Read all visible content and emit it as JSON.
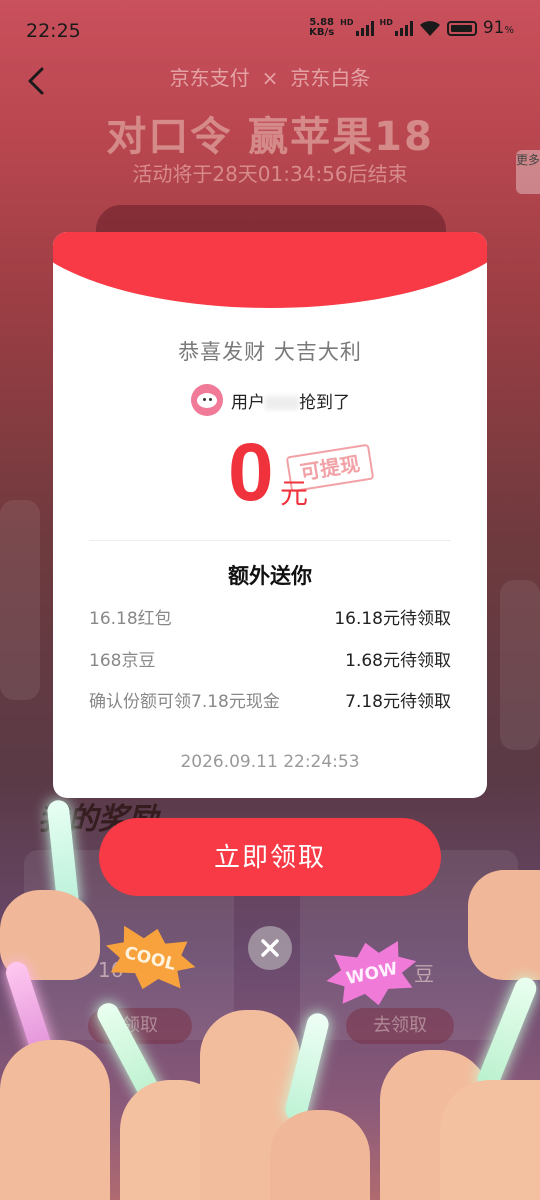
{
  "status_bar": {
    "time": "22:25",
    "net_speed_value": "5.88",
    "net_speed_unit": "KB/s",
    "hd_label": "HD",
    "battery_percent": "91"
  },
  "background": {
    "brand_left": "京东支付",
    "brand_sep": "×",
    "brand_right": "京东白条",
    "title": "对口令 赢苹果18",
    "countdown": "活动将于28天01:34:56后结束",
    "side_tab": "更多",
    "section_title": "我的奖励",
    "card_left_label": "16",
    "card_right_label": "豆",
    "pill_left": "领取",
    "pill_right": "去领取"
  },
  "dialog": {
    "slogan": "恭喜发财 大吉大利",
    "user_prefix": "用户",
    "user_suffix": "抢到了",
    "amount": "0",
    "amount_unit": "元",
    "stamp": "可提现",
    "extra_title": "额外送你",
    "rewards": [
      {
        "name": "16.18红包",
        "value": "16.18元待领取"
      },
      {
        "name": "168京豆",
        "value": "1.68元待领取"
      },
      {
        "name": "确认份额可领7.18元现金",
        "value": "7.18元待领取"
      }
    ],
    "timestamp": "2026.09.11 22:24:53"
  },
  "cta": {
    "label": "立即领取"
  },
  "badges": {
    "cool": "COOL",
    "wow": "WOW"
  },
  "colors": {
    "accent": "#f73a45",
    "amount": "#f0323c"
  }
}
